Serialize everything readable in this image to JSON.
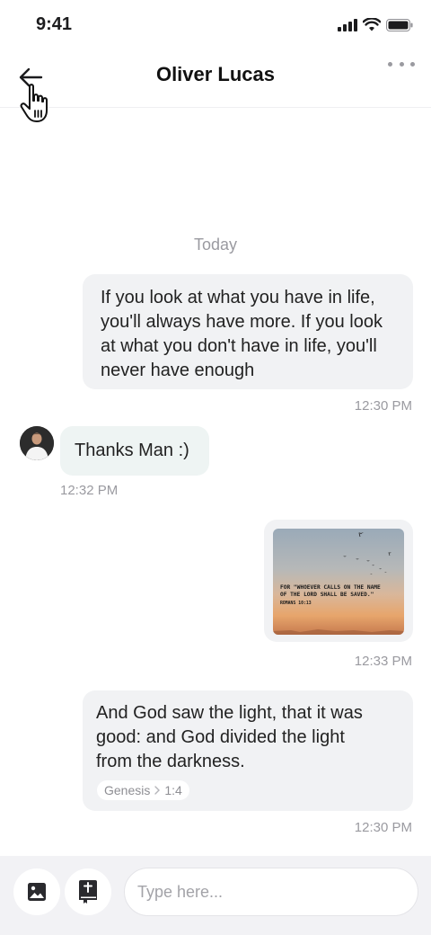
{
  "status_bar": {
    "time": "9:41"
  },
  "header": {
    "contact_name": "Oliver Lucas",
    "back_icon": "arrow-left-icon",
    "more_icon": "more-horizontal-icon"
  },
  "conversation": {
    "date_separator": "Today",
    "messages": [
      {
        "direction": "outgoing",
        "lines": [
          "If you look at what you have in life,",
          "you'll always have more. If you look",
          "at what you don't have in life, you'll",
          "never have enough"
        ],
        "time": "12:30 PM"
      },
      {
        "direction": "incoming",
        "text": "Thanks Man :)",
        "time": "12:32 PM"
      },
      {
        "direction": "outgoing",
        "type": "image",
        "image_quote_line1": "FOR \"WHOEVER CALLS ON THE NAME",
        "image_quote_line2": "OF THE LORD SHALL BE SAVED.\"",
        "image_reference": "ROMANS 10:13",
        "time": "12:33 PM"
      },
      {
        "direction": "outgoing",
        "lines": [
          "And God saw the light, that it was",
          "good: and God divided the light",
          "from the darkness."
        ],
        "verse_book": "Genesis",
        "verse_ref": "1:4",
        "time": "12:30 PM"
      }
    ]
  },
  "composer": {
    "placeholder": "Type here...",
    "image_button_icon": "image-icon",
    "bible_button_icon": "bible-icon"
  },
  "colors": {
    "outgoing_bubble": "#f1f2f4",
    "incoming_bubble": "#eef4f3",
    "composer_bg": "#f2f2f5",
    "muted_text": "#9a9aa0"
  }
}
